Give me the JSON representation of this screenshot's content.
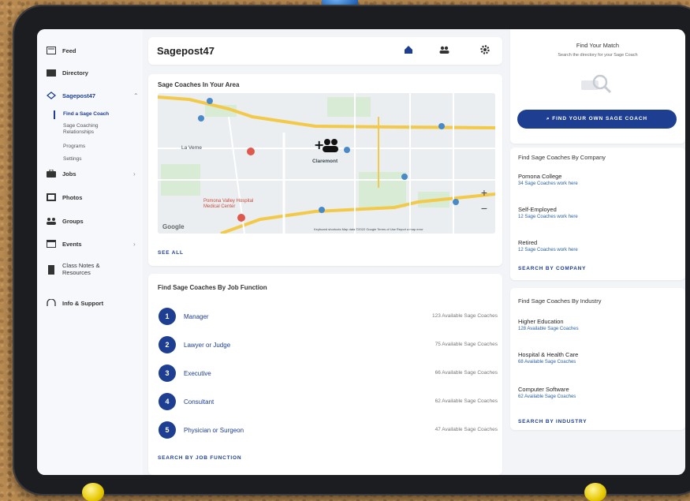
{
  "sidebar": {
    "items": [
      {
        "label": "Feed",
        "icon": "feed-icon"
      },
      {
        "label": "Directory",
        "icon": "directory-icon"
      },
      {
        "label": "Sagepost47",
        "icon": "sagepost-icon"
      },
      {
        "label": "Jobs",
        "icon": "briefcase-icon"
      },
      {
        "label": "Photos",
        "icon": "photos-icon"
      },
      {
        "label": "Groups",
        "icon": "groups-icon"
      },
      {
        "label": "Events",
        "icon": "calendar-icon"
      },
      {
        "label": "Class Notes & Resources",
        "icon": "notes-icon"
      },
      {
        "label": "Info & Support",
        "icon": "support-icon"
      }
    ],
    "subitems": [
      "Find a Sage Coach",
      "Sage Coaching Relationships",
      "Programs",
      "Settings"
    ]
  },
  "header": {
    "title": "Sagepost47"
  },
  "map_card": {
    "title": "Sage Coaches In Your Area",
    "see_all": "SEE ALL",
    "labels": {
      "claremont": "Claremont",
      "la_verne": "La Verne",
      "pomona_valley": "Pomona Valley Hospital Medical Center",
      "google": "Google",
      "footer": "Keyboard shortcuts   Map data ©2022 Google   Terms of Use   Report a map error"
    }
  },
  "job_card": {
    "title": "Find Sage Coaches By Job Function",
    "rows": [
      {
        "num": "1",
        "name": "Manager",
        "count": "123 Available Sage Coaches"
      },
      {
        "num": "2",
        "name": "Lawyer or Judge",
        "count": "75 Available Sage Coaches"
      },
      {
        "num": "3",
        "name": "Executive",
        "count": "66 Available Sage Coaches"
      },
      {
        "num": "4",
        "name": "Consultant",
        "count": "62 Available Sage Coaches"
      },
      {
        "num": "5",
        "name": "Physician or Surgeon",
        "count": "47 Available Sage Coaches"
      }
    ],
    "search_link": "SEARCH BY JOB FUNCTION"
  },
  "match_card": {
    "title": "Find Your Match",
    "subtitle": "Search the directory for your Sage Coach",
    "button": "FIND YOUR OWN SAGE COACH"
  },
  "company_card": {
    "title": "Find Sage Coaches By Company",
    "items": [
      {
        "name": "Pomona College",
        "sub": "34 Sage Coaches work here"
      },
      {
        "name": "Self-Employed",
        "sub": "12 Sage Coaches work here"
      },
      {
        "name": "Retired",
        "sub": "12 Sage Coaches work here"
      }
    ],
    "search_link": "SEARCH BY COMPANY"
  },
  "industry_card": {
    "title": "Find Sage Coaches By Industry",
    "items": [
      {
        "name": "Higher Education",
        "sub": "128 Available Sage Coaches"
      },
      {
        "name": "Hospital & Health Care",
        "sub": "68 Available Sage Coaches"
      },
      {
        "name": "Computer Software",
        "sub": "62 Available Sage Coaches"
      }
    ],
    "search_link": "SEARCH BY INDUSTRY"
  },
  "colors": {
    "primary": "#1d3e91",
    "background": "#f3f4f7",
    "card": "#ffffff"
  }
}
